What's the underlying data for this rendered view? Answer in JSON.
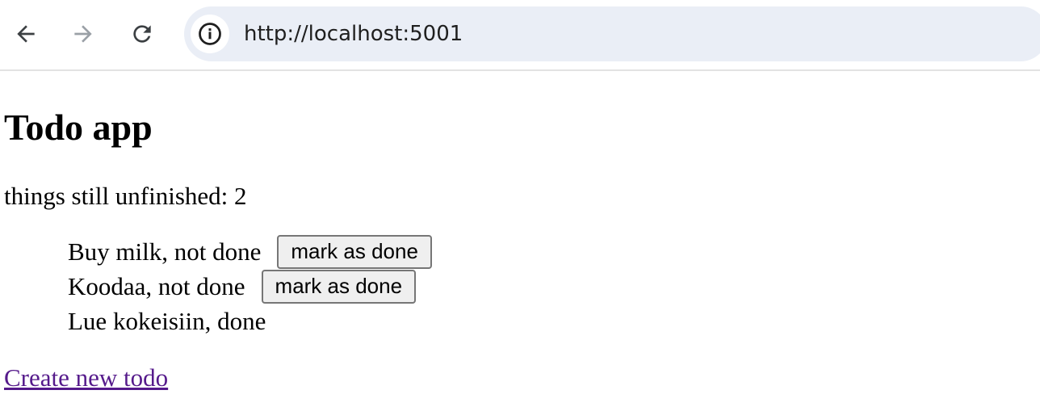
{
  "browser": {
    "url": "http://localhost:5001",
    "back_icon": "arrow-left-icon",
    "forward_icon": "arrow-right-icon",
    "reload_icon": "reload-icon",
    "site_info_icon": "info-icon"
  },
  "page": {
    "title": "Todo app",
    "unfinished_text": "things still unfinished: 2",
    "todos": [
      {
        "text": "Buy milk, not done",
        "button_label": "mark as done"
      },
      {
        "text": "Koodaa, not done",
        "button_label": "mark as done"
      },
      {
        "text": "Lue kokeisiin, done"
      }
    ],
    "create_link": "Create new todo"
  },
  "colors": {
    "address_bar_bg": "#eaeef6",
    "visited_link": "#551a8b",
    "button_bg": "#efefef"
  }
}
